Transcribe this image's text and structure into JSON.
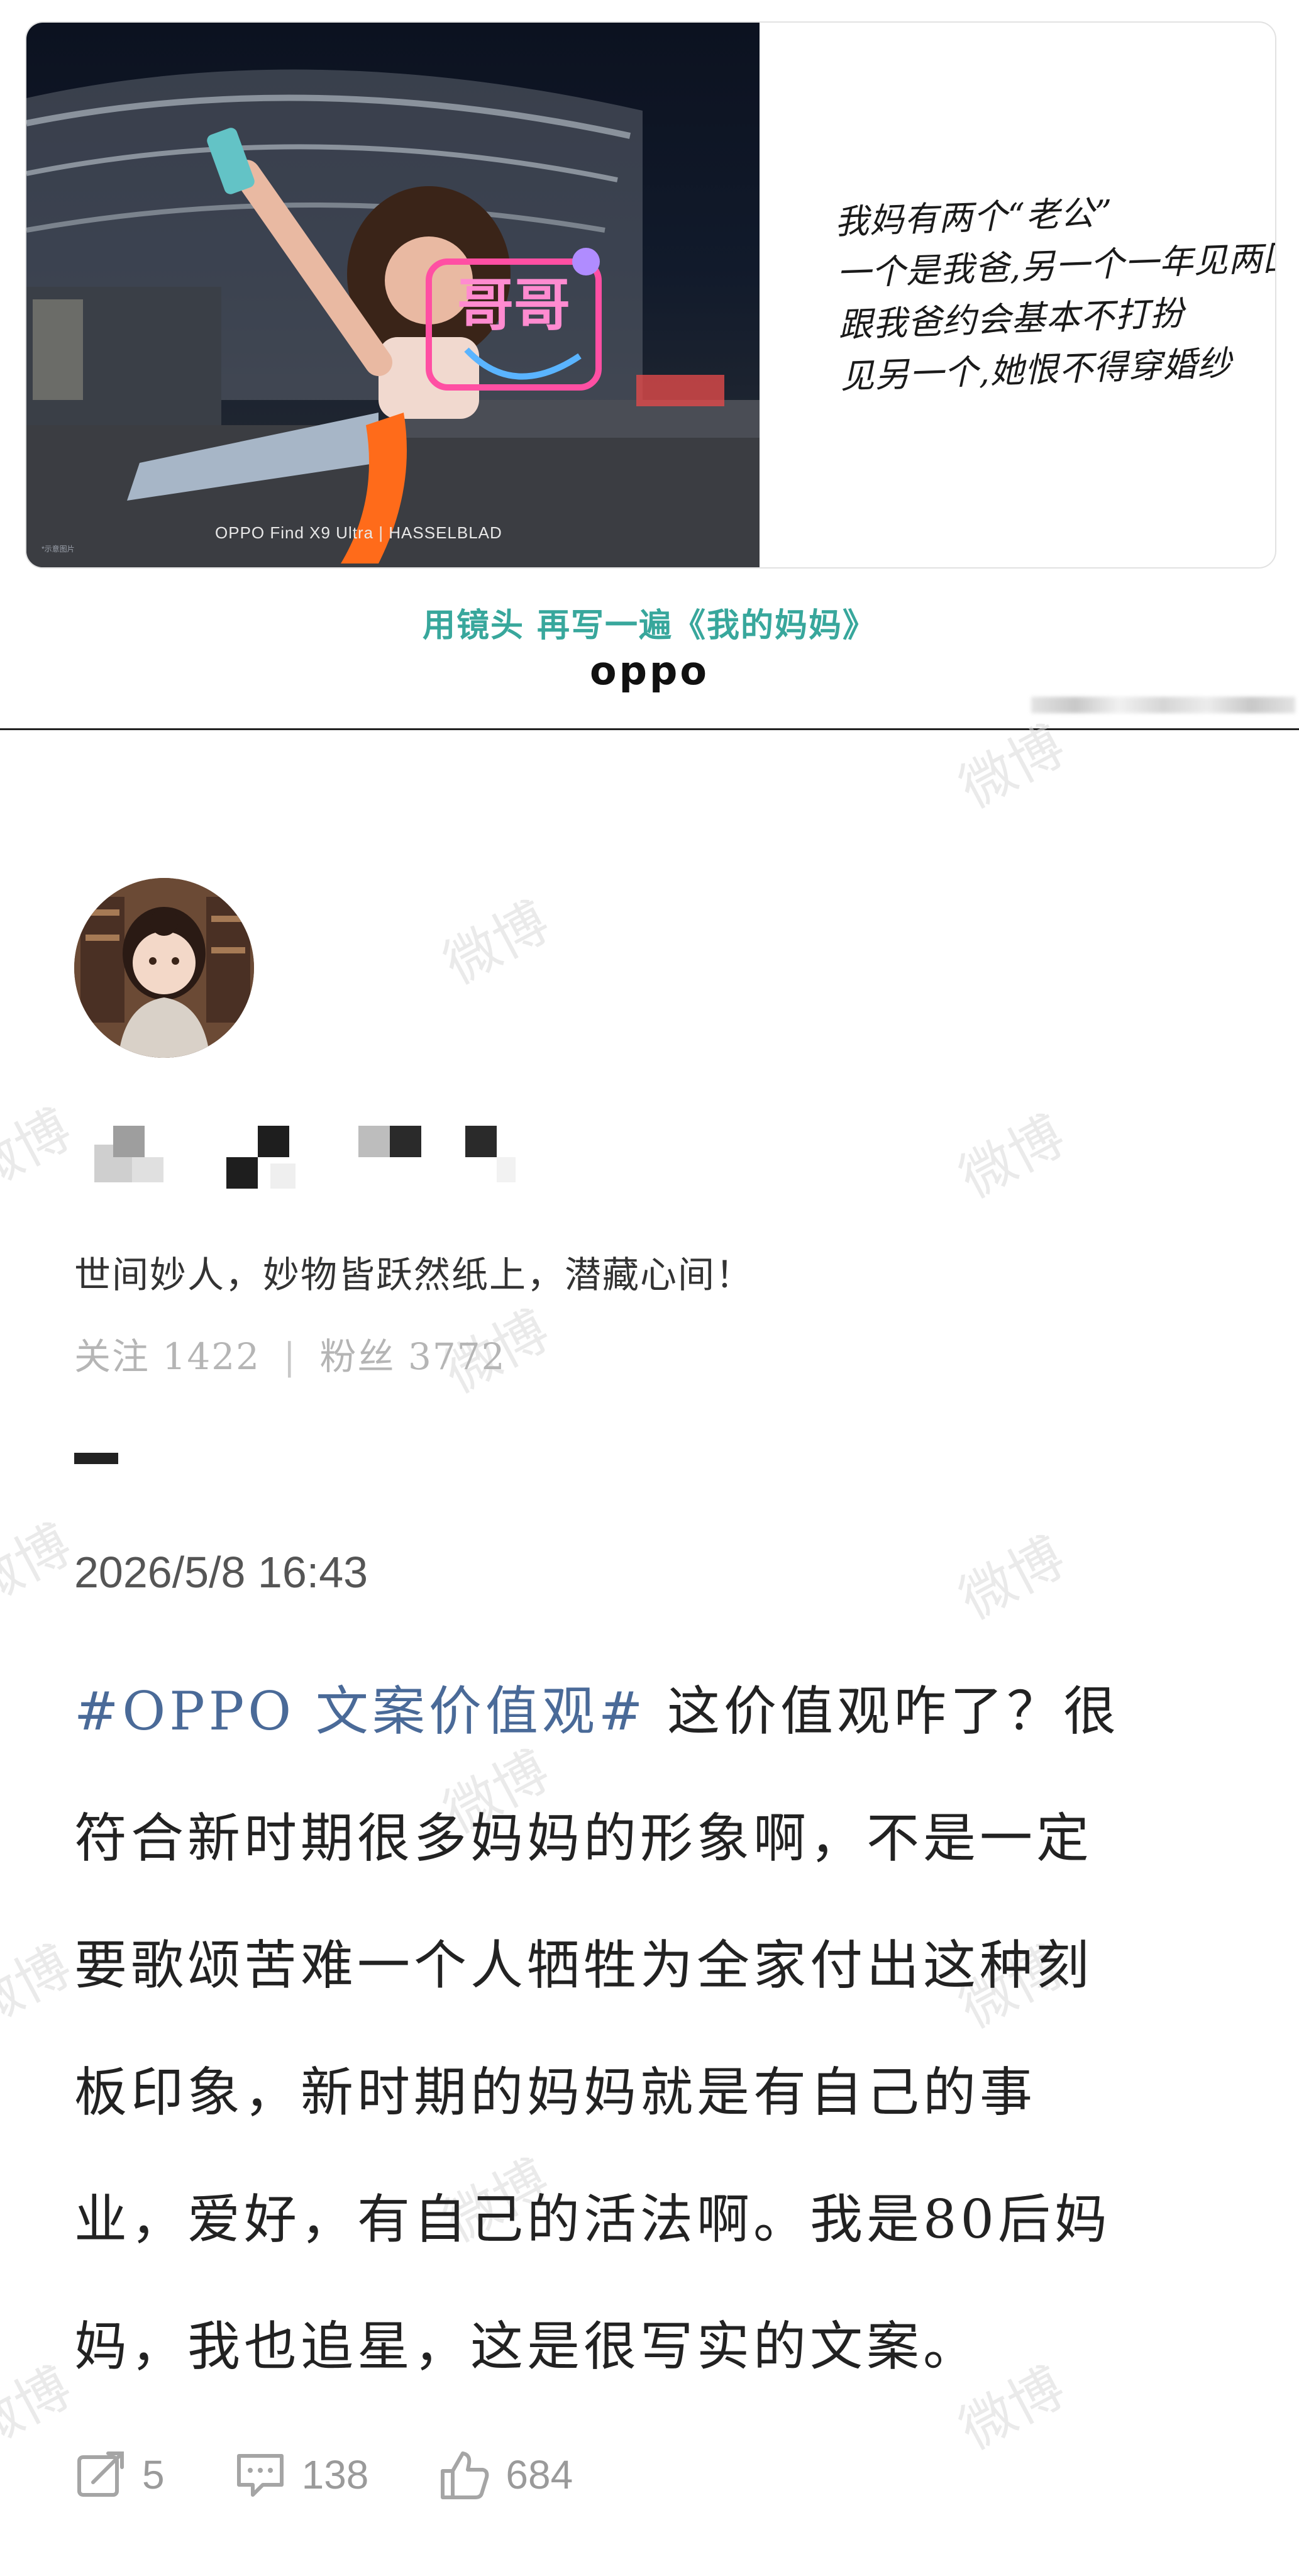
{
  "ad": {
    "photo_caption": "OPPO Find X9 Ultra  |  HASSELBLAD",
    "photo_footnote": "*示意图片",
    "neon_sign": "哥哥",
    "copy_lines": [
      "我妈有两个“老公”",
      "一个是我爸,另一个一年见两回",
      "跟我爸约会基本不打扮",
      "见另一个,她恨不得穿婚纱"
    ],
    "slogan": "用镜头 再写一遍《我的妈妈》",
    "brand": "oppo",
    "colors": {
      "slogan": "#38a79c"
    }
  },
  "watermark": "微博",
  "profile": {
    "bio": "世间妙人，妙物皆跃然纸上，潜藏心间！",
    "following_label": "关注",
    "following_count": "1422",
    "fans_label": "粉丝",
    "fans_count": "3772",
    "separator": "|"
  },
  "post": {
    "timestamp": "2026/5/8 16:43",
    "hashtag": "#OPPO 文案价值观#",
    "lines": [
      " 这价值观咋了？很",
      "符合新时期很多妈妈的形象啊，不是一定",
      "要歌颂苦难一个人牺牲为全家付出这种刻",
      "板印象，新时期的妈妈就是有自己的事",
      "业，爱好，有自己的活法啊。我是80后妈",
      "妈，我也追星，这是很写实的文案。"
    ],
    "colors": {
      "hashtag": "#4a6a98"
    }
  },
  "actions": {
    "repost": {
      "icon": "repost-icon",
      "count": "5"
    },
    "comment": {
      "icon": "comment-icon",
      "count": "138"
    },
    "like": {
      "icon": "thumbs-up-icon",
      "count": "684"
    }
  }
}
